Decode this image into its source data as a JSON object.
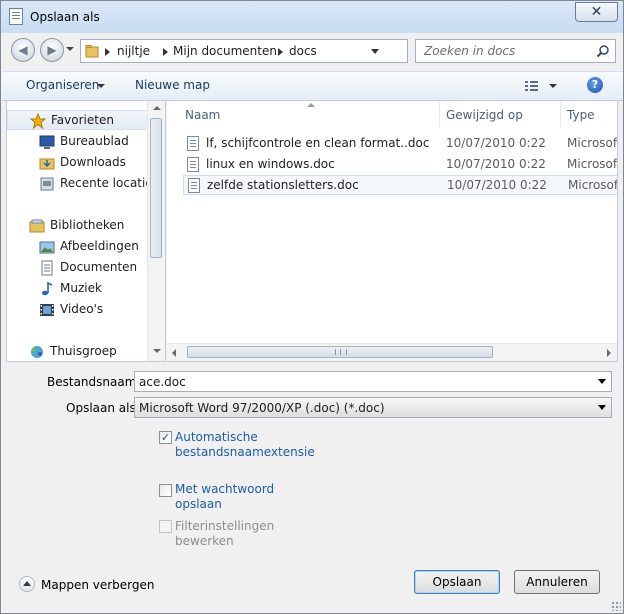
{
  "window": {
    "title": "Opslaan als",
    "close_glyph": "✕"
  },
  "address": {
    "crumbs": [
      "nijltje",
      "Mijn documenten",
      "docs"
    ],
    "search_placeholder": "Zoeken in docs"
  },
  "toolbar": {
    "organize_label": "Organiseren",
    "new_folder_label": "Nieuwe map"
  },
  "nav": {
    "favorites_label": "Favorieten",
    "favorites": [
      {
        "label": "Bureaublad",
        "icon": "desktop-icon"
      },
      {
        "label": "Downloads",
        "icon": "downloads-folder-icon"
      },
      {
        "label": "Recente locaties",
        "icon": "recent-places-icon"
      }
    ],
    "libraries_label": "Bibliotheken",
    "libraries": [
      {
        "label": "Afbeeldingen",
        "icon": "pictures-icon"
      },
      {
        "label": "Documenten",
        "icon": "documents-icon"
      },
      {
        "label": "Muziek",
        "icon": "music-icon"
      },
      {
        "label": "Video's",
        "icon": "videos-icon"
      }
    ],
    "homegroup_label": "Thuisgroep"
  },
  "files": {
    "columns": {
      "name": "Naam",
      "modified": "Gewijzigd op",
      "type": "Type"
    },
    "rows": [
      {
        "name": "lf, schijfcontrole en clean format..doc",
        "modified": "10/07/2010 0:22",
        "type": "Microsoft"
      },
      {
        "name": "linux en windows.doc",
        "modified": "10/07/2010 0:22",
        "type": "Microsoft"
      },
      {
        "name": "zelfde stationsletters.doc",
        "modified": "10/07/2010 0:22",
        "type": "Microsoft"
      }
    ]
  },
  "form": {
    "filename_label": "Bestandsnaam:",
    "filename_value": "ace.doc",
    "savetype_label": "Opslaan als:",
    "savetype_value": "Microsoft Word 97/2000/XP (.doc) (*.doc)",
    "auto_ext_line1": "Automatische",
    "auto_ext_line2": "bestandsnaamextensie",
    "auto_ext_checked": true,
    "password_line1": "Met wachtwoord",
    "password_line2": "opslaan",
    "password_checked": false,
    "filter_line1": "Filterinstellingen",
    "filter_line2": "bewerken",
    "filter_checked": false
  },
  "footer": {
    "hide_folders_label": "Mappen verbergen",
    "save_label": "Opslaan",
    "cancel_label": "Annuleren"
  },
  "colors": {
    "accent": "#1c5ca8",
    "titlebar": "#c7dbf1"
  }
}
